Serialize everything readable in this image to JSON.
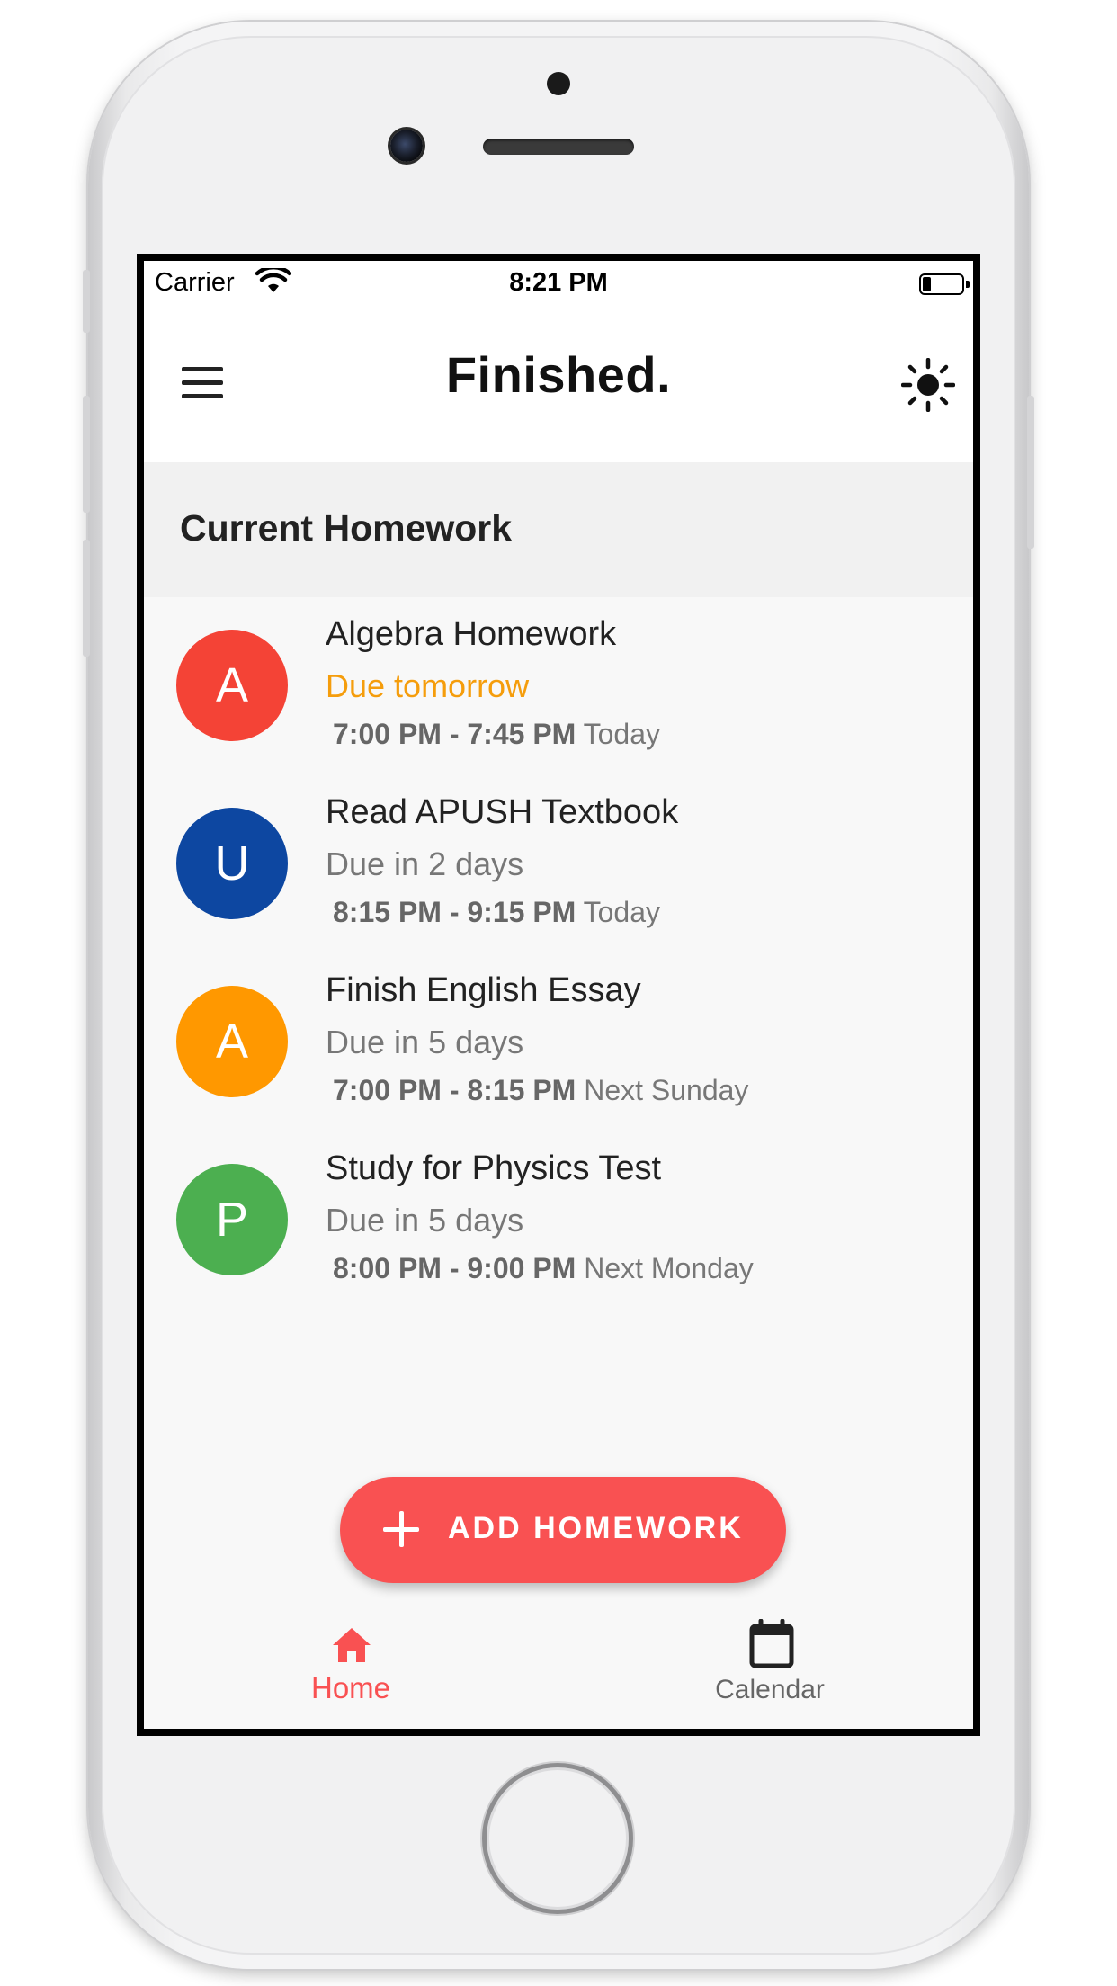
{
  "status_bar": {
    "carrier": "Carrier",
    "time": "8:21 PM",
    "wifi_icon": "wifi-icon",
    "battery_icon": "battery-low-icon"
  },
  "app_bar": {
    "title": "Finished.",
    "menu_icon": "hamburger-menu-icon",
    "theme_icon": "sun-icon"
  },
  "section": {
    "title": "Current Homework"
  },
  "homework": [
    {
      "initial": "A",
      "title": "Algebra Homework",
      "due": "Due tomorrow",
      "time_range": "7:00 PM - 7:45 PM",
      "day": "Today",
      "color": "#f44336",
      "urgent": true
    },
    {
      "initial": "U",
      "title": "Read APUSH Textbook",
      "due": "Due in 2 days",
      "time_range": "8:15 PM - 9:15 PM",
      "day": "Today",
      "color": "#0d47a1",
      "urgent": false
    },
    {
      "initial": "A",
      "title": "Finish English Essay",
      "due": "Due in 5 days",
      "time_range": "7:00 PM - 8:15 PM",
      "day": "Next Sunday",
      "color": "#ff9800",
      "urgent": false
    },
    {
      "initial": "P",
      "title": "Study for Physics Test",
      "due": "Due in 5 days",
      "time_range": "8:00 PM - 9:00 PM",
      "day": "Next Monday",
      "color": "#4caf50",
      "urgent": false
    }
  ],
  "fab": {
    "label": "ADD HOMEWORK",
    "icon": "plus-icon",
    "color": "#f95152"
  },
  "bottom_nav": {
    "items": [
      {
        "label": "Home",
        "icon": "home-icon",
        "active": true
      },
      {
        "label": "Calendar",
        "icon": "calendar-icon",
        "active": false
      }
    ],
    "active_color": "#f95152"
  },
  "colors": {
    "due_urgent": "#f59d0c"
  }
}
